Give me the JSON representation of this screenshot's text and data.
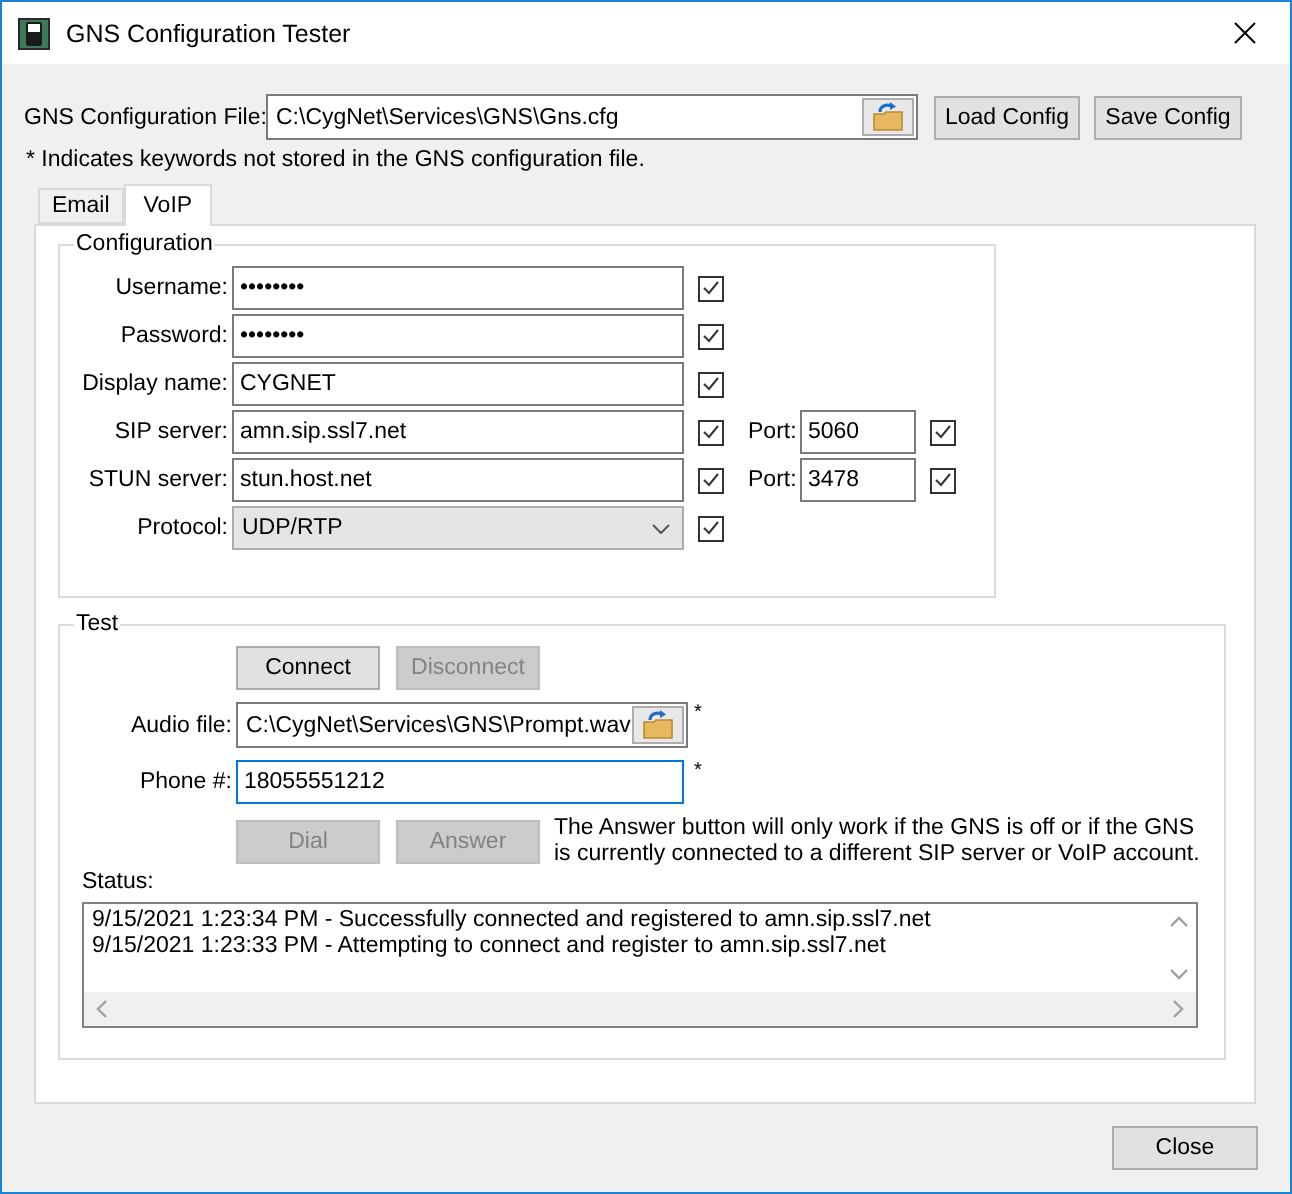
{
  "window": {
    "title": "GNS Configuration Tester"
  },
  "config_file": {
    "label": "GNS Configuration File:",
    "value": "C:\\CygNet\\Services\\GNS\\Gns.cfg"
  },
  "top_buttons": [
    "Load Config",
    "Save Config"
  ],
  "note": "* Indicates keywords not stored in the GNS configuration file.",
  "tabs": [
    {
      "label": "Email",
      "selected": false
    },
    {
      "label": "VoIP",
      "selected": true
    }
  ],
  "configuration": {
    "title": "Configuration",
    "fields": [
      {
        "kind": "text",
        "label": "Username:",
        "value": "••••••••",
        "checked": true
      },
      {
        "kind": "text",
        "label": "Password:",
        "value": "••••••••",
        "checked": true
      },
      {
        "kind": "text",
        "label": "Display name:",
        "value": "CYGNET",
        "checked": true
      },
      {
        "kind": "text",
        "label": "SIP server:",
        "value": "amn.sip.ssl7.net",
        "checked": true,
        "port": {
          "label": "Port:",
          "value": "5060",
          "checked": true
        }
      },
      {
        "kind": "text",
        "label": "STUN server:",
        "value": "stun.host.net",
        "checked": true,
        "port": {
          "label": "Port:",
          "value": "3478",
          "checked": true
        }
      },
      {
        "kind": "select",
        "label": "Protocol:",
        "value": "UDP/RTP",
        "checked": true
      }
    ]
  },
  "test": {
    "title": "Test",
    "connect_buttons": [
      {
        "label": "Connect",
        "disabled": false
      },
      {
        "label": "Disconnect",
        "disabled": true
      }
    ],
    "audio_file": {
      "label": "Audio file:",
      "value": "C:\\CygNet\\Services\\GNS\\Prompt.wav",
      "marker": "*"
    },
    "phone": {
      "label": "Phone #:",
      "value": "18055551212",
      "marker": "*",
      "focused": true
    },
    "call_buttons": [
      {
        "label": "Dial",
        "disabled": true
      },
      {
        "label": "Answer",
        "disabled": true
      }
    ],
    "hint_lines": [
      "The Answer button will only work if the GNS is off or if the GNS",
      "is currently connected to a different SIP server or VoIP account."
    ],
    "status_label": "Status:",
    "status_lines": [
      "9/15/2021 1:23:34 PM - Successfully connected and registered to amn.sip.ssl7.net",
      "9/15/2021 1:23:33 PM - Attempting to connect and register to amn.sip.ssl7.net"
    ]
  },
  "close_button": "Close"
}
